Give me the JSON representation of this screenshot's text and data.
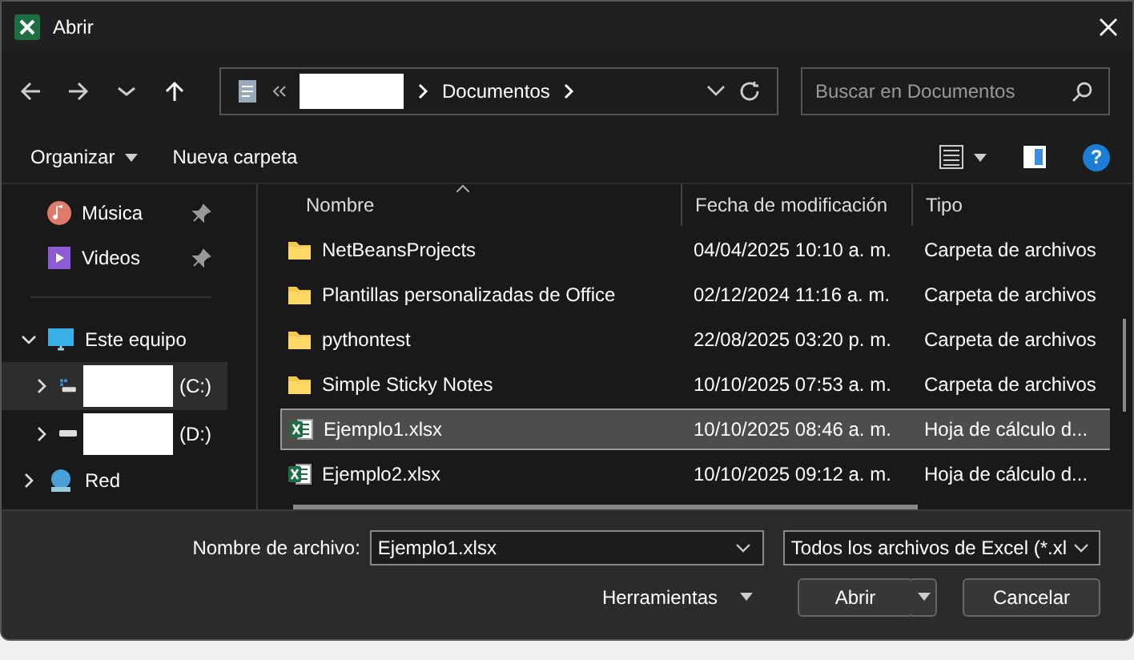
{
  "window": {
    "title": "Abrir"
  },
  "address": {
    "segments": [
      "Documentos"
    ],
    "redacted": true
  },
  "search": {
    "placeholder": "Buscar en Documentos"
  },
  "toolbar": {
    "buttons": [
      "Organizar",
      "Nueva carpeta"
    ],
    "help": "?"
  },
  "nav_pane": {
    "items": [
      {
        "kind": "music",
        "label": "Música",
        "pinned": true,
        "selected": false
      },
      {
        "kind": "videos",
        "label": "Videos",
        "pinned": true,
        "selected": false
      },
      {
        "kind": "pc",
        "label": "Este equipo",
        "expanded": true,
        "selected": false,
        "children": [
          {
            "kind": "system-drive",
            "label": "(C:)",
            "expanded": false,
            "selected": true
          },
          {
            "kind": "drive",
            "label": "(D:)",
            "expanded": false,
            "selected": false
          }
        ]
      },
      {
        "kind": "network",
        "label": "Red",
        "expanded": false,
        "selected": false
      }
    ]
  },
  "table": {
    "columns": [
      "Nombre",
      "Fecha de modificación",
      "Tipo"
    ],
    "rows": [
      {
        "kind": "folder",
        "name": "NetBeansProjects",
        "date": "04/04/2025 10:10 a. m.",
        "type": "Carpeta de archivos",
        "selected": false
      },
      {
        "kind": "folder",
        "name": "Plantillas personalizadas de Office",
        "date": "02/12/2024 11:16 a. m.",
        "type": "Carpeta de archivos",
        "selected": false
      },
      {
        "kind": "folder",
        "name": "pythontest",
        "date": "22/08/2025 03:20 p. m.",
        "type": "Carpeta de archivos",
        "selected": false
      },
      {
        "kind": "folder",
        "name": "Simple Sticky Notes",
        "date": "10/10/2025 07:53 a. m.",
        "type": "Carpeta de archivos",
        "selected": false
      },
      {
        "kind": "excel",
        "name": "Ejemplo1.xlsx",
        "date": "10/10/2025 08:46 a. m.",
        "type": "Hoja de cálculo d...",
        "selected": true
      },
      {
        "kind": "excel",
        "name": "Ejemplo2.xlsx",
        "date": "10/10/2025 09:12 a. m.",
        "type": "Hoja de cálculo d...",
        "selected": false
      }
    ]
  },
  "footer": {
    "filename_label": "Nombre de archivo:",
    "filename": "Ejemplo1.xlsx",
    "filter": "Todos los archivos de Excel (*.xl",
    "tools": "Herramientas",
    "open": "Abrir",
    "cancel": "Cancelar"
  }
}
